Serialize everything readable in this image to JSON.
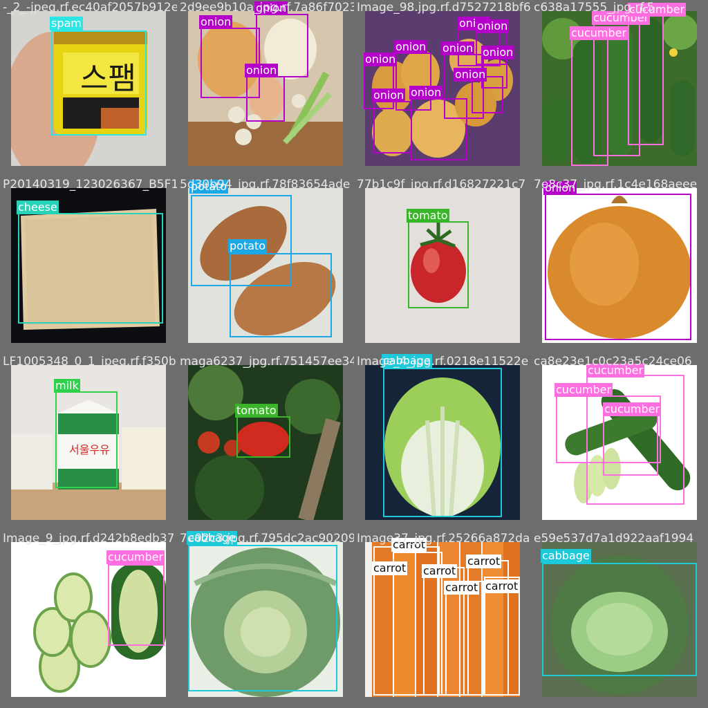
{
  "colors": {
    "spam": "#2ce5e5",
    "onion": "#b400c8",
    "cucumber": "#ff6ee0",
    "cheese": "#26d3b7",
    "potato": "#1aa8e6",
    "tomato": "#3ab52a",
    "milk": "#2fd14c",
    "cabbage": "#1bc9d8",
    "carrot": "#ffffff"
  },
  "tiles": [
    {
      "filename": "-_2_-jpeg.rf.ec40af2057b912ec9df39f92",
      "photo_subject": "spam can in hand",
      "labels": [
        {
          "cls": "spam",
          "text": "spam"
        }
      ]
    },
    {
      "filename": "2d9ee9b10a_jpg.rf.7a86f7023830ca",
      "photo_subject": "onions and garlic",
      "labels": [
        {
          "cls": "onion",
          "text": "onion"
        },
        {
          "cls": "onion",
          "text": "onion"
        },
        {
          "cls": "onion",
          "text": "onion"
        }
      ]
    },
    {
      "filename": "Image_98.jpg.rf.d7527218bf63a7",
      "photo_subject": "pile of onions",
      "labels": [
        {
          "cls": "onion",
          "text": "onion"
        },
        {
          "cls": "onion",
          "text": "onion"
        },
        {
          "cls": "onion",
          "text": "onion"
        },
        {
          "cls": "onion",
          "text": "onion"
        },
        {
          "cls": "onion",
          "text": "onion"
        },
        {
          "cls": "onion",
          "text": "onion"
        },
        {
          "cls": "onion",
          "text": "onion"
        },
        {
          "cls": "onion",
          "text": "onion"
        },
        {
          "cls": "onion",
          "text": "onion"
        }
      ]
    },
    {
      "filename": "c638a17555_jpg.rf.5",
      "photo_subject": "cucumbers on vine",
      "labels": [
        {
          "cls": "cucumber",
          "text": "cucumber"
        },
        {
          "cls": "cucumber",
          "text": "cucumber"
        },
        {
          "cls": "cucumber",
          "text": "cucumber"
        }
      ]
    },
    {
      "filename": "P20140319_123026367_B5F1",
      "photo_subject": "cheese slice",
      "labels": [
        {
          "cls": "cheese",
          "text": "cheese"
        }
      ]
    },
    {
      "filename": "5d30b94_jpg.rf.78f83654ade",
      "photo_subject": "sweet potatoes",
      "labels": [
        {
          "cls": "potato",
          "text": "potato"
        },
        {
          "cls": "potato",
          "text": "potato"
        }
      ]
    },
    {
      "filename": "77b1c9f_jpg.rf.d16827221c7",
      "photo_subject": "single tomato",
      "labels": [
        {
          "cls": "tomato",
          "text": "tomato"
        }
      ]
    },
    {
      "filename": "7e8c37_jpg.rf.1c4e168aeee",
      "photo_subject": "large onion",
      "labels": [
        {
          "cls": "onion",
          "text": "onion"
        }
      ]
    },
    {
      "filename": "LF1005348_0_1_jpeg.rf.f350b",
      "photo_subject": "milk carton",
      "labels": [
        {
          "cls": "milk",
          "text": "milk"
        }
      ]
    },
    {
      "filename": "maga6237_jpg.rf.751457ee342d88",
      "photo_subject": "tomato on plant",
      "labels": [
        {
          "cls": "tomato",
          "text": "tomato"
        }
      ]
    },
    {
      "filename": "Image_4_jpg.rf.0218e11522e",
      "photo_subject": "napa cabbage",
      "labels": [
        {
          "cls": "cabbage",
          "text": "cabbage"
        }
      ]
    },
    {
      "filename": "ca8e23e1c0c23a5c24ce06",
      "photo_subject": "cucumbers on white",
      "labels": [
        {
          "cls": "cucumber",
          "text": "cucumber"
        },
        {
          "cls": "cucumber",
          "text": "cucumber"
        },
        {
          "cls": "cucumber",
          "text": "cucumber"
        }
      ]
    },
    {
      "filename": "Image_9_jpg.rf.d242b8edb37",
      "photo_subject": "sliced cucumber",
      "labels": [
        {
          "cls": "cucumber",
          "text": "cucumber"
        }
      ]
    },
    {
      "filename": "7e02c3.jpg.rf.795dc2ac90209",
      "photo_subject": "green cabbage",
      "labels": [
        {
          "cls": "cabbage",
          "text": "cabbage"
        }
      ]
    },
    {
      "filename": "Image37_jpg.rf.25266a872da17",
      "photo_subject": "bunch of carrots",
      "labels": [
        {
          "cls": "carrot",
          "text": "carrot"
        },
        {
          "cls": "carrot",
          "text": "carrot"
        },
        {
          "cls": "carrot",
          "text": "carrot"
        },
        {
          "cls": "carrot",
          "text": "carrot"
        },
        {
          "cls": "carrot",
          "text": "carrot"
        },
        {
          "cls": "carrot",
          "text": "carrot"
        }
      ]
    },
    {
      "filename": "e59e537d7a1d922aaf1994",
      "photo_subject": "cabbage head",
      "labels": [
        {
          "cls": "cabbage",
          "text": "cabbage"
        }
      ]
    }
  ]
}
